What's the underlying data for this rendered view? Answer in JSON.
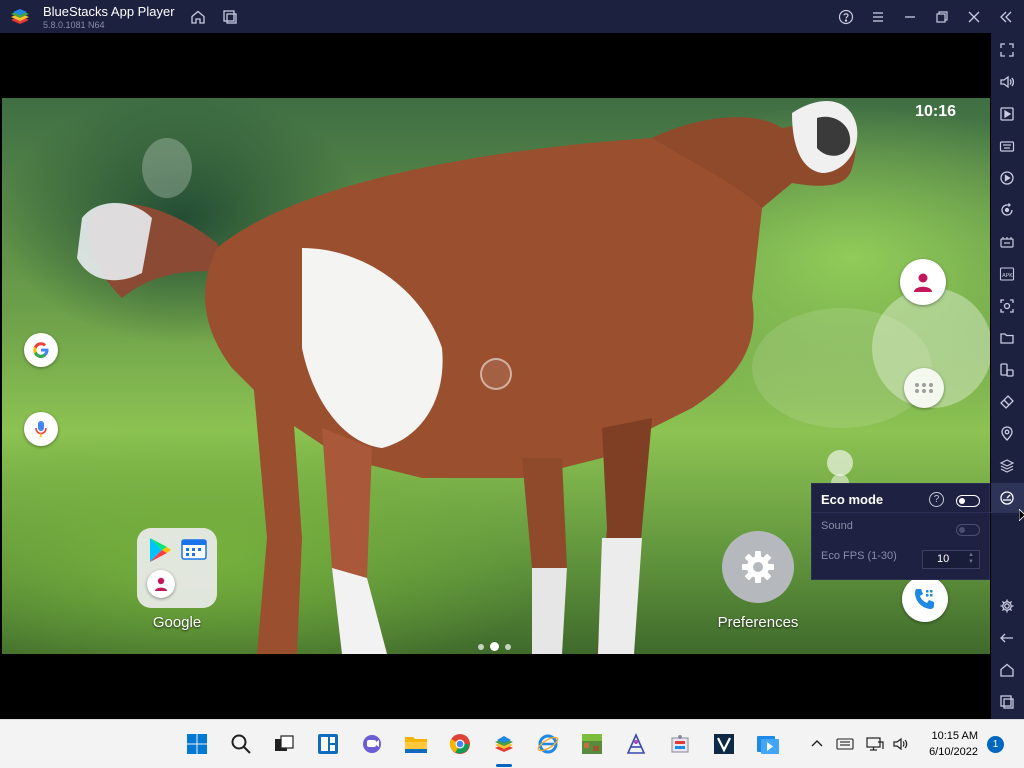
{
  "window": {
    "title": "BlueStacks App Player",
    "version": "5.8.0.1081 N64"
  },
  "android": {
    "clock": "10:16",
    "apps": {
      "folder_label": "Google",
      "preferences_label": "Preferences"
    },
    "page_count": 3,
    "current_page": 2
  },
  "eco_popup": {
    "title": "Eco mode",
    "help_symbol": "?",
    "eco_enabled": false,
    "sound_label": "Sound",
    "sound_enabled": false,
    "fps_label": "Eco FPS (1-30)",
    "fps_value": "10"
  },
  "taskbar": {
    "time": "10:15 AM",
    "date": "6/10/2022",
    "notification_count": "1"
  },
  "colors": {
    "chrome": "#1d2140",
    "accent": "#0067c0"
  }
}
